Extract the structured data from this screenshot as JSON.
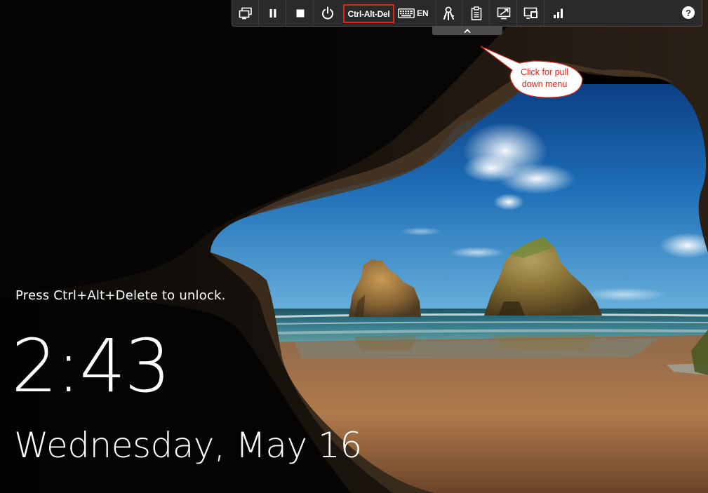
{
  "lock_screen": {
    "hint": "Press Ctrl+Alt+Delete to unlock.",
    "time": "2:43",
    "date": "Wednesday, May 16"
  },
  "toolbar": {
    "items": [
      {
        "name": "display-icon"
      },
      {
        "name": "pause-icon"
      },
      {
        "name": "stop-icon"
      },
      {
        "name": "power-icon"
      },
      {
        "name": "ctrl-alt-del-button",
        "label": "Ctrl-Alt-Del"
      },
      {
        "name": "keyboard-icon",
        "label": "EN"
      },
      {
        "name": "keys-icon"
      },
      {
        "name": "clipboard-icon"
      },
      {
        "name": "resize-icon"
      },
      {
        "name": "screens-icon"
      },
      {
        "name": "signal-icon"
      },
      {
        "name": "help-icon",
        "label": "?"
      }
    ],
    "lang_label": "EN",
    "cad_label": "Ctrl-Alt-Del",
    "help_label": "?",
    "pull_tab_icon": "chevron-up-icon"
  },
  "annotation": {
    "text_line1": "Click for pull",
    "text_line2": "down menu",
    "color": "#e0251b"
  },
  "colors": {
    "toolbar_bg": "#2a2a2a",
    "highlight": "#e0251b",
    "sky": "#1f6fb5",
    "sand": "#a8744a",
    "sea": "#2f6c7a"
  }
}
